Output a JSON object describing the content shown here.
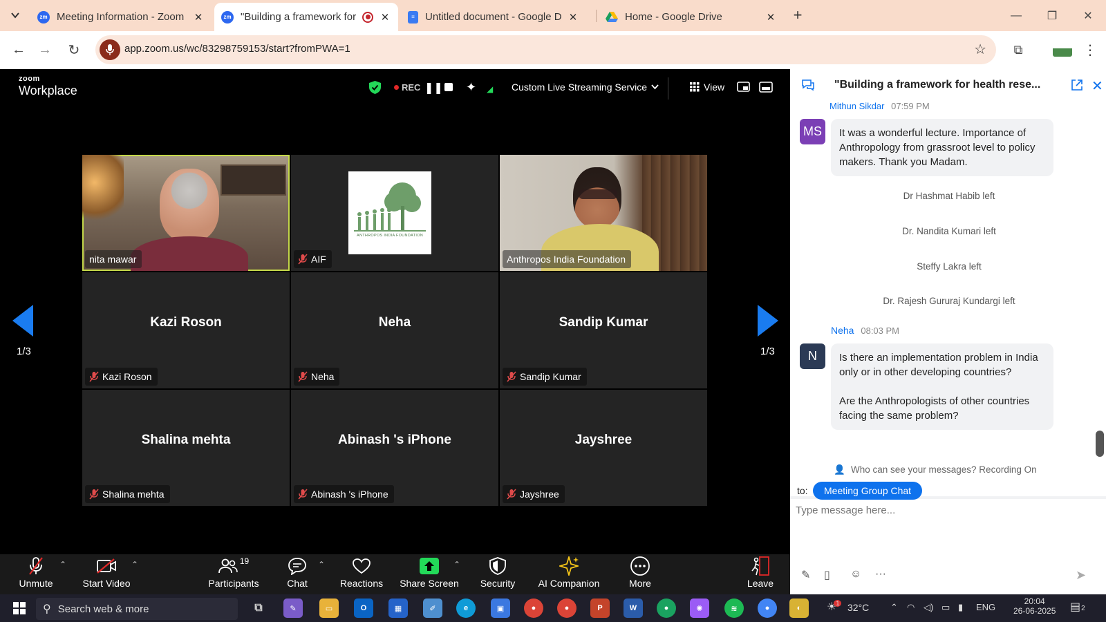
{
  "browser": {
    "tabs": [
      {
        "title": "Meeting Information - Zoom",
        "favicon": "zm"
      },
      {
        "title": "\"Building a framework for h",
        "favicon": "zm"
      },
      {
        "title": "Untitled document - Google Do",
        "favicon": "docs"
      },
      {
        "title": "Home - Google Drive",
        "favicon": "drive"
      }
    ],
    "url": "app.zoom.us/wc/83298759153/start?fromPWA=1"
  },
  "zoom": {
    "logo_small": "zoom",
    "logo_big": "Workplace",
    "header": {
      "rec_label": "REC",
      "streaming_label": "Custom Live Streaming Service",
      "view_label": "View"
    },
    "tiles": [
      {
        "tag": "nita mawar",
        "name": ""
      },
      {
        "tag": "AIF",
        "name": ""
      },
      {
        "tag": "Anthropos India Foundation",
        "name": ""
      },
      {
        "tag": "Kazi Roson",
        "name": "Kazi Roson"
      },
      {
        "tag": "Neha",
        "name": "Neha"
      },
      {
        "tag": "Sandip Kumar",
        "name": "Sandip Kumar"
      },
      {
        "tag": "Shalina mehta",
        "name": "Shalina mehta"
      },
      {
        "tag": "Abinash 's iPhone",
        "name": "Abinash 's iPhone"
      },
      {
        "tag": "Jayshree",
        "name": "Jayshree"
      }
    ],
    "aif_logo_text": "ANTHROPOS INDIA FOUNDATION",
    "page_indicator": "1/3",
    "toolbar": {
      "unmute": "Unmute",
      "start_video": "Start Video",
      "participants": "Participants",
      "participants_count": "19",
      "chat": "Chat",
      "reactions": "Reactions",
      "share_screen": "Share Screen",
      "security": "Security",
      "ai_companion": "AI Companion",
      "more": "More",
      "leave": "Leave"
    }
  },
  "chat": {
    "title": "\"Building a framework for health rese...",
    "partial_sender": "Mithun Sikdar",
    "partial_time": "07:59 PM",
    "messages": [
      {
        "initials": "MS",
        "avatar_color": "#7b3fb5",
        "text": "It was a wonderful lecture. Importance of Anthropology from grassroot level to policy makers. Thank you Madam."
      }
    ],
    "system": [
      "Dr Hashmat Habib left",
      "Dr. Nandita Kumari left",
      "Steffy Lakra left",
      "Dr. Rajesh Gururaj Kundargi left"
    ],
    "neha_sender": "Neha",
    "neha_time": "08:03 PM",
    "neha_initial": "N",
    "neha_avatar_color": "#2b3a55",
    "neha_text_1": "Is there an implementation problem in India only or in other developing countries?",
    "neha_text_2": "Are the Anthropologists of other countries facing the same problem?",
    "visibility_note": "Who can see your messages? Recording On",
    "to_label": "to:",
    "recipient": "Meeting Group Chat",
    "placeholder": "Type message here..."
  },
  "taskbar": {
    "search_placeholder": "Search web & more",
    "temperature": "32°C",
    "language": "ENG",
    "time": "20:04",
    "date": "26-06-2025",
    "notifications": "2",
    "weather_badge": "1"
  },
  "colors": {
    "zoom_blue": "#0e72ed",
    "tab_strip": "#f9dccb",
    "active_speaker": "#c5d94a",
    "arrow_blue": "#1a7cf0"
  }
}
